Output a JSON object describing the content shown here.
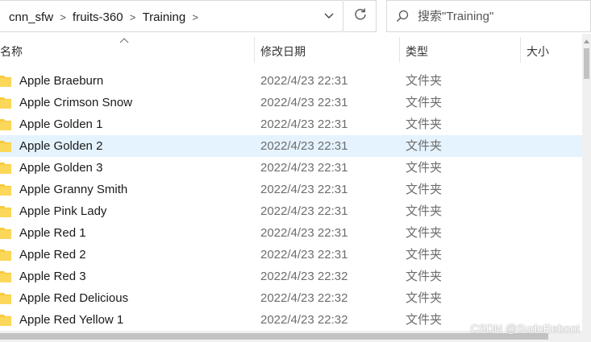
{
  "breadcrumb": {
    "items": [
      {
        "label": "cnn_sfw"
      },
      {
        "label": "fruits-360"
      },
      {
        "label": "Training"
      }
    ],
    "separator": ">"
  },
  "search": {
    "placeholder": "搜索\"Training\""
  },
  "icons": {
    "dropdown": "chevron-down-icon",
    "refresh": "refresh-icon",
    "search": "search-icon",
    "folder": "folder-icon",
    "sort": "sort-ascending-icon"
  },
  "colors": {
    "selected_row": "#e5f3ff",
    "folder": "#f8c93a",
    "secondary_text": "#6d6d6d"
  },
  "columns": {
    "name": "名称",
    "date": "修改日期",
    "type": "类型",
    "size": "大小"
  },
  "files": [
    {
      "name": "Apple Braeburn",
      "date": "2022/4/23 22:31",
      "type": "文件夹",
      "selected": false
    },
    {
      "name": "Apple Crimson Snow",
      "date": "2022/4/23 22:31",
      "type": "文件夹",
      "selected": false
    },
    {
      "name": "Apple Golden 1",
      "date": "2022/4/23 22:31",
      "type": "文件夹",
      "selected": false
    },
    {
      "name": "Apple Golden 2",
      "date": "2022/4/23 22:31",
      "type": "文件夹",
      "selected": true
    },
    {
      "name": "Apple Golden 3",
      "date": "2022/4/23 22:31",
      "type": "文件夹",
      "selected": false
    },
    {
      "name": "Apple Granny Smith",
      "date": "2022/4/23 22:31",
      "type": "文件夹",
      "selected": false
    },
    {
      "name": "Apple Pink Lady",
      "date": "2022/4/23 22:31",
      "type": "文件夹",
      "selected": false
    },
    {
      "name": "Apple Red 1",
      "date": "2022/4/23 22:31",
      "type": "文件夹",
      "selected": false
    },
    {
      "name": "Apple Red 2",
      "date": "2022/4/23 22:31",
      "type": "文件夹",
      "selected": false
    },
    {
      "name": "Apple Red 3",
      "date": "2022/4/23 22:32",
      "type": "文件夹",
      "selected": false
    },
    {
      "name": "Apple Red Delicious",
      "date": "2022/4/23 22:32",
      "type": "文件夹",
      "selected": false
    },
    {
      "name": "Apple Red Yellow 1",
      "date": "2022/4/23 22:32",
      "type": "文件夹",
      "selected": false
    }
  ],
  "watermark": "CSDN @SudoReboot"
}
